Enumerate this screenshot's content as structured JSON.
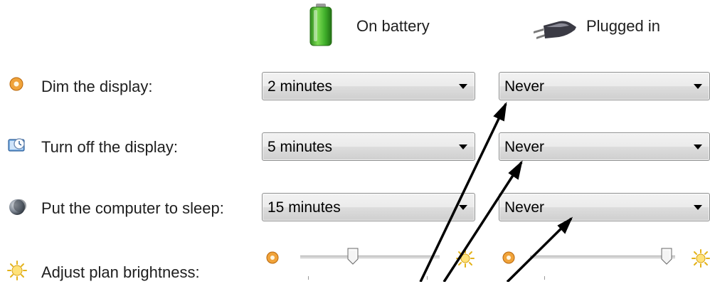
{
  "header": {
    "on_battery_label": "On battery",
    "plugged_in_label": "Plugged in",
    "battery_icon": "battery-icon",
    "plug_icon": "power-plug-icon"
  },
  "rows": [
    {
      "label": "Dim the display:",
      "icon": "dim-display-icon",
      "on_battery": "2 minutes",
      "plugged_in": "Never"
    },
    {
      "label": "Turn off the display:",
      "icon": "display-off-icon",
      "on_battery": "5 minutes",
      "plugged_in": "Never"
    },
    {
      "label": "Put the computer to sleep:",
      "icon": "sleep-icon",
      "on_battery": "15 minutes",
      "plugged_in": "Never"
    }
  ],
  "brightness": {
    "label": "Adjust plan brightness:",
    "icon": "brightness-sun-icon",
    "on_battery_level": 0.38,
    "plugged_in_level": 1.0
  },
  "annotations": {
    "arrow_color": "#000000",
    "arrow_count": 3
  },
  "colors": {
    "battery_green": "#3fae2a",
    "dim_orange": "#e08a14"
  }
}
